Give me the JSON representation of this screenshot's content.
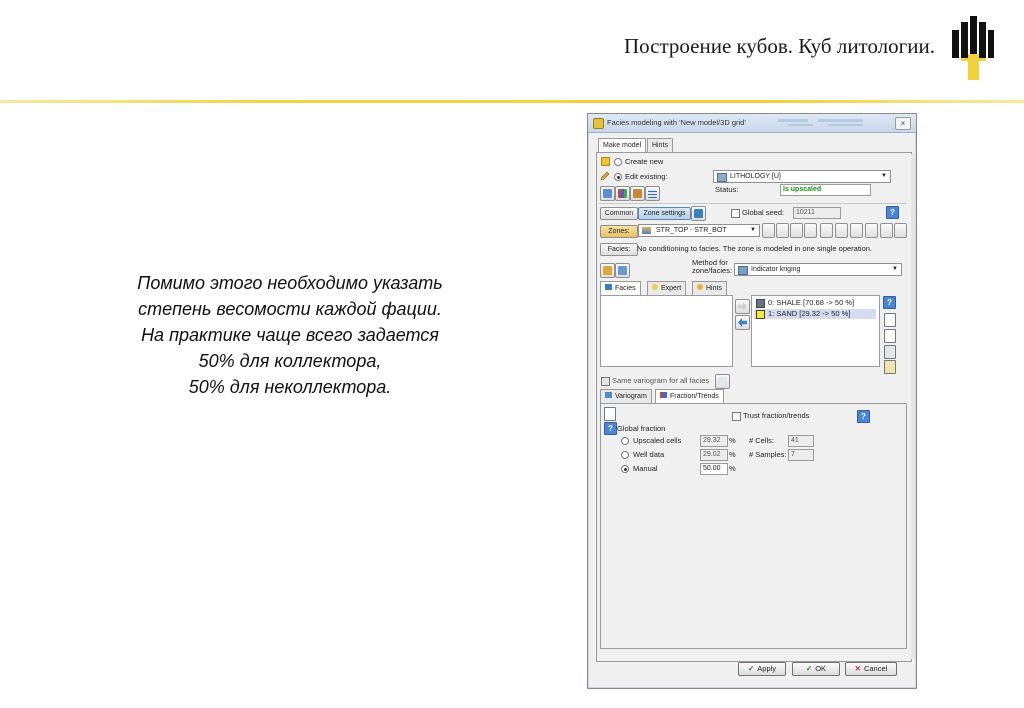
{
  "slide": {
    "title": "Построение кубов. Куб литологии.",
    "body_lines": [
      "Помимо этого необходимо указать",
      "степень весомости каждой фации.",
      "На практике чаще всего задается",
      "50% для коллектора,",
      "50% для неколлектора."
    ],
    "colors": {
      "accent_line": "#f2cf3c",
      "logo_black": "#111111",
      "logo_gold": "#f2d23c"
    }
  },
  "dialog": {
    "title": "Facies modeling with 'New model/3D grid'",
    "close_glyph": "×",
    "tabs": [
      "Make model",
      "Hints"
    ],
    "create_new_label": "Create new",
    "edit_existing_label": "Edit existing:",
    "property_value": "LITHOLOGY [U]",
    "status_label": "Status:",
    "status_value": "Is upscaled",
    "common_button": "Common",
    "zone_settings_button": "Zone settings",
    "global_seed_label": "Global seed:",
    "global_seed_value": "10211",
    "zones_button": "Zones:",
    "zone_value": "STR_TOP - STR_BOT",
    "facies_button": "Facies:",
    "facies_note": "No conditioning to facies. The zone is modeled in one single operation.",
    "method_label_1": "Method for",
    "method_label_2": "zone/facies:",
    "method_value": "Indicator kriging",
    "inner_tabs": [
      "Facies",
      "Expert",
      "Hints"
    ],
    "facies_list": [
      {
        "label": "0: SHALE [70.68 -> 50 %]",
        "color": "#6b7280",
        "selected": false
      },
      {
        "label": "1: SAND [29.32 -> 50 %]",
        "color": "#f4ec2a",
        "selected": true
      }
    ],
    "same_variogram_label": "Same variogram for all facies",
    "sub_tabs": [
      "Variogram",
      "Fraction/Trends"
    ],
    "trust_label": "Trust fraction/trends",
    "global_fraction_label": "Global fraction",
    "fraction_rows": [
      {
        "label": "Upscaled cells",
        "value": "29.32",
        "unit": "%",
        "extra_label": "# Cells:",
        "extra_value": "41",
        "selected": false
      },
      {
        "label": "Well data",
        "value": "29.02",
        "unit": "%",
        "extra_label": "# Samples:",
        "extra_value": "7",
        "selected": false
      },
      {
        "label": "Manual",
        "value": "50.00",
        "unit": "%",
        "extra_label": "",
        "extra_value": "",
        "selected": true
      }
    ],
    "apply_button": "Apply",
    "ok_button": "OK",
    "cancel_button": "Cancel",
    "apply_mark": "✓",
    "ok_mark": "✓",
    "cancel_mark": "✕",
    "help_glyph": "?"
  }
}
